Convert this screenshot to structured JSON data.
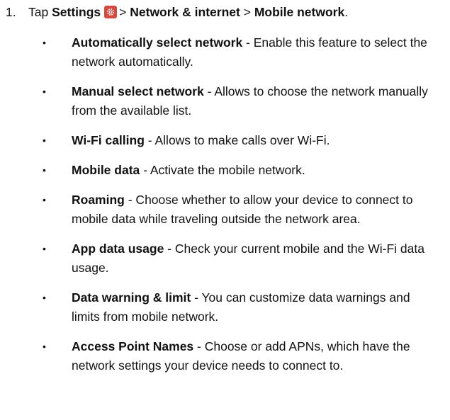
{
  "step": {
    "number": "1.",
    "prefix": "Tap",
    "path_first": "Settings",
    "icon": "settings-gear-icon",
    "separator": ">",
    "path_second": "Network & internet",
    "path_third": "Mobile network",
    "end": "."
  },
  "bullets": [
    {
      "title": "Automatically select network",
      "desc": " - Enable this feature to select the network automatically."
    },
    {
      "title": "Manual select network",
      "desc": " - Allows to choose the network manually from the available list."
    },
    {
      "title": "Wi-Fi calling",
      "desc": " - Allows to make calls over Wi-Fi."
    },
    {
      "title": "Mobile data",
      "desc": " - Activate the mobile network."
    },
    {
      "title": "Roaming",
      "desc": " - Choose whether to allow your device to connect to mobile data while traveling outside the network area."
    },
    {
      "title": "App data usage",
      "desc": " - Check your current mobile and the Wi-Fi data usage."
    },
    {
      "title": "Data warning & limit",
      "desc": " - You can customize data warnings and limits from mobile network."
    },
    {
      "title": "Access Point Names",
      "desc": " - Choose or add APNs, which have the network settings your device needs to connect to."
    }
  ],
  "bullet_symbol": "•",
  "colors": {
    "text": "#111111",
    "icon_background": "#d9473e"
  }
}
